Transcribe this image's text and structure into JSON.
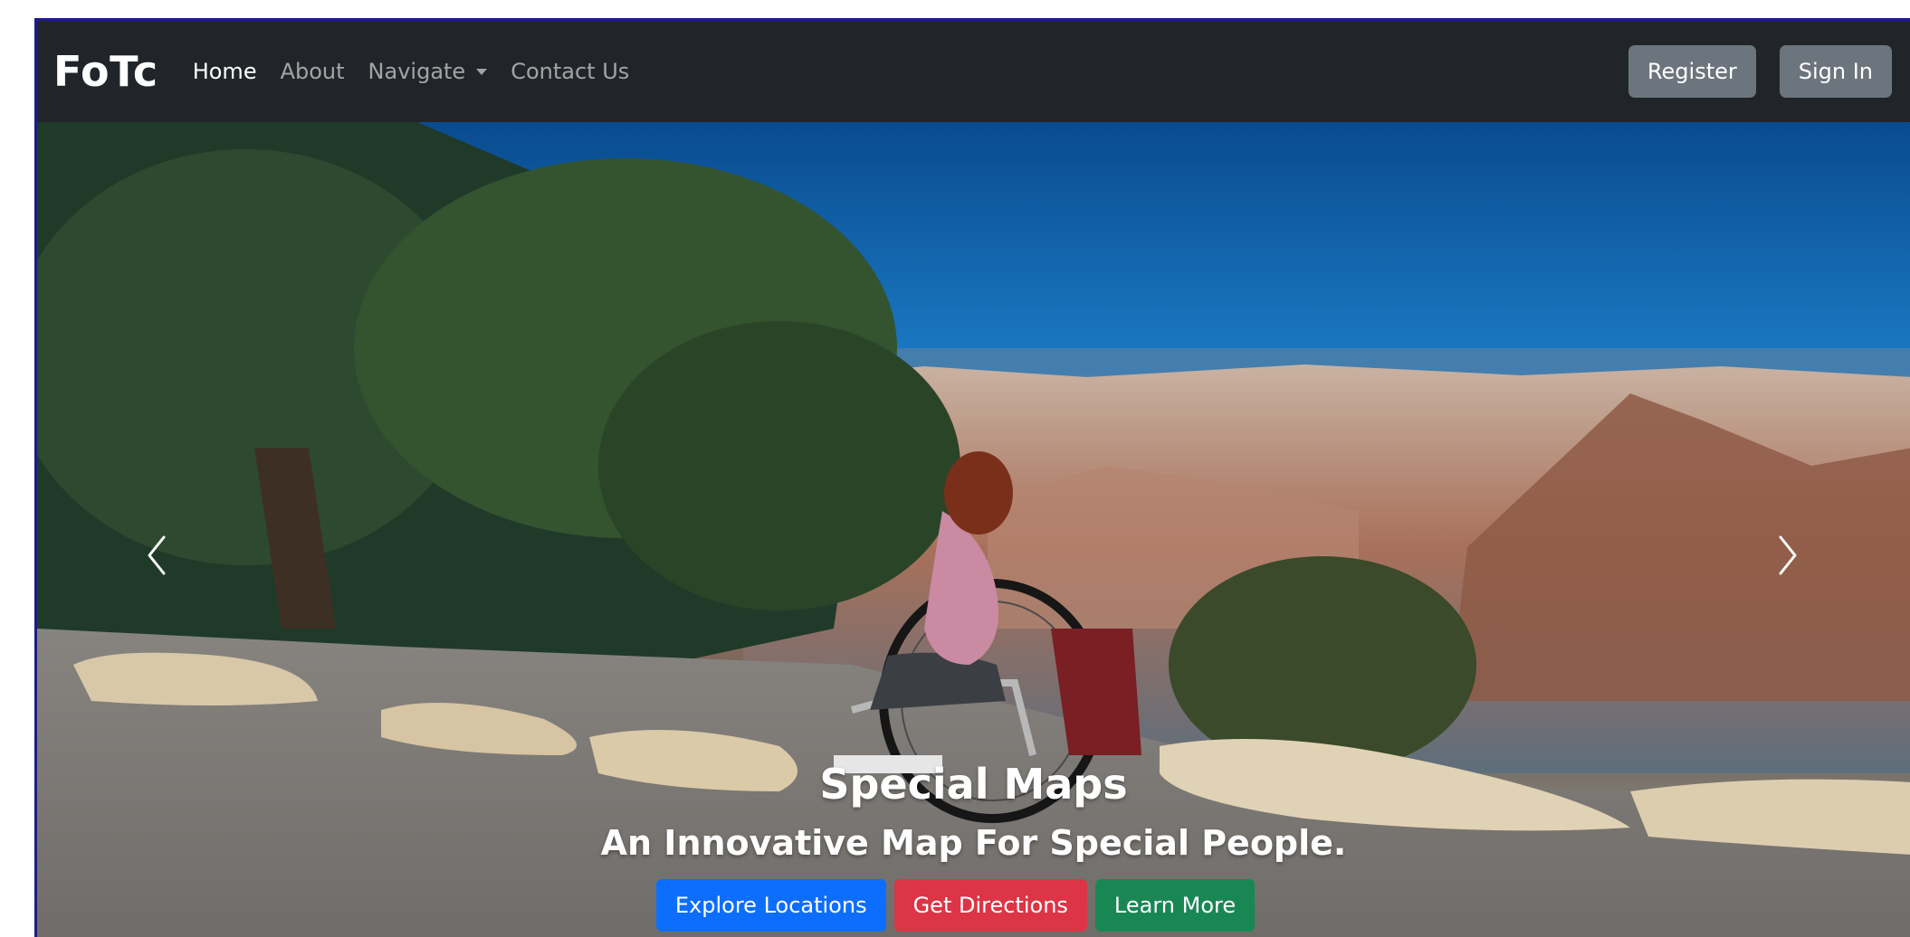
{
  "navbar": {
    "brand": "FoTc",
    "links": [
      {
        "label": "Home",
        "active": true
      },
      {
        "label": "About",
        "active": false
      },
      {
        "label": "Navigate",
        "active": false
      },
      {
        "label": "Contact Us",
        "active": false
      }
    ],
    "register_label": "Register",
    "signin_label": "Sign In"
  },
  "carousel": {
    "slide_count": 3,
    "active_index": 0,
    "caption": {
      "title": "Special Maps",
      "subtitle": "An Innovative Map For Special People."
    },
    "buttons": {
      "explore_label": "Explore Locations",
      "directions_label": "Get Directions",
      "learn_label": "Learn More"
    },
    "prev_icon": "chevron-left-icon",
    "next_icon": "chevron-right-icon"
  },
  "colors": {
    "navbar_bg": "#212529",
    "secondary": "#6c757d",
    "primary": "#0d6efd",
    "danger": "#dc3545",
    "success": "#198754"
  }
}
